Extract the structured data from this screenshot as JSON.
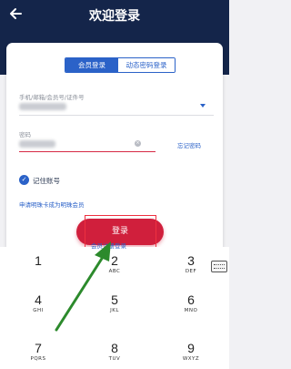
{
  "header": {
    "title": "欢迎登录",
    "back_icon": "arrow-left-icon"
  },
  "tabs": [
    {
      "label": "会员登录",
      "active": true
    },
    {
      "label": "动态密码登录",
      "active": false
    }
  ],
  "account": {
    "label": "手机/邮箱/会员号/证件号"
  },
  "password": {
    "label": "密码",
    "forgot_label": "忘记密码",
    "clear_glyph": "×"
  },
  "remember": {
    "label": "记住账号",
    "checked": true
  },
  "apply_link": "申请明珠卡成为明珠会员",
  "login_button": "登录",
  "register_link": "会员注册登录",
  "keypad": [
    {
      "num": "1",
      "letters": ""
    },
    {
      "num": "2",
      "letters": "ABC"
    },
    {
      "num": "3",
      "letters": "DEF"
    },
    {
      "num": "4",
      "letters": "GHI"
    },
    {
      "num": "5",
      "letters": "JKL"
    },
    {
      "num": "6",
      "letters": "MNO"
    },
    {
      "num": "7",
      "letters": "PQRS"
    },
    {
      "num": "8",
      "letters": "TUV"
    },
    {
      "num": "9",
      "letters": "WXYZ"
    }
  ],
  "colors": {
    "brand_navy": "#14254a",
    "accent_blue": "#2b62c8",
    "login_red": "#d01f3c",
    "annotation_green": "#2c8a2c"
  }
}
